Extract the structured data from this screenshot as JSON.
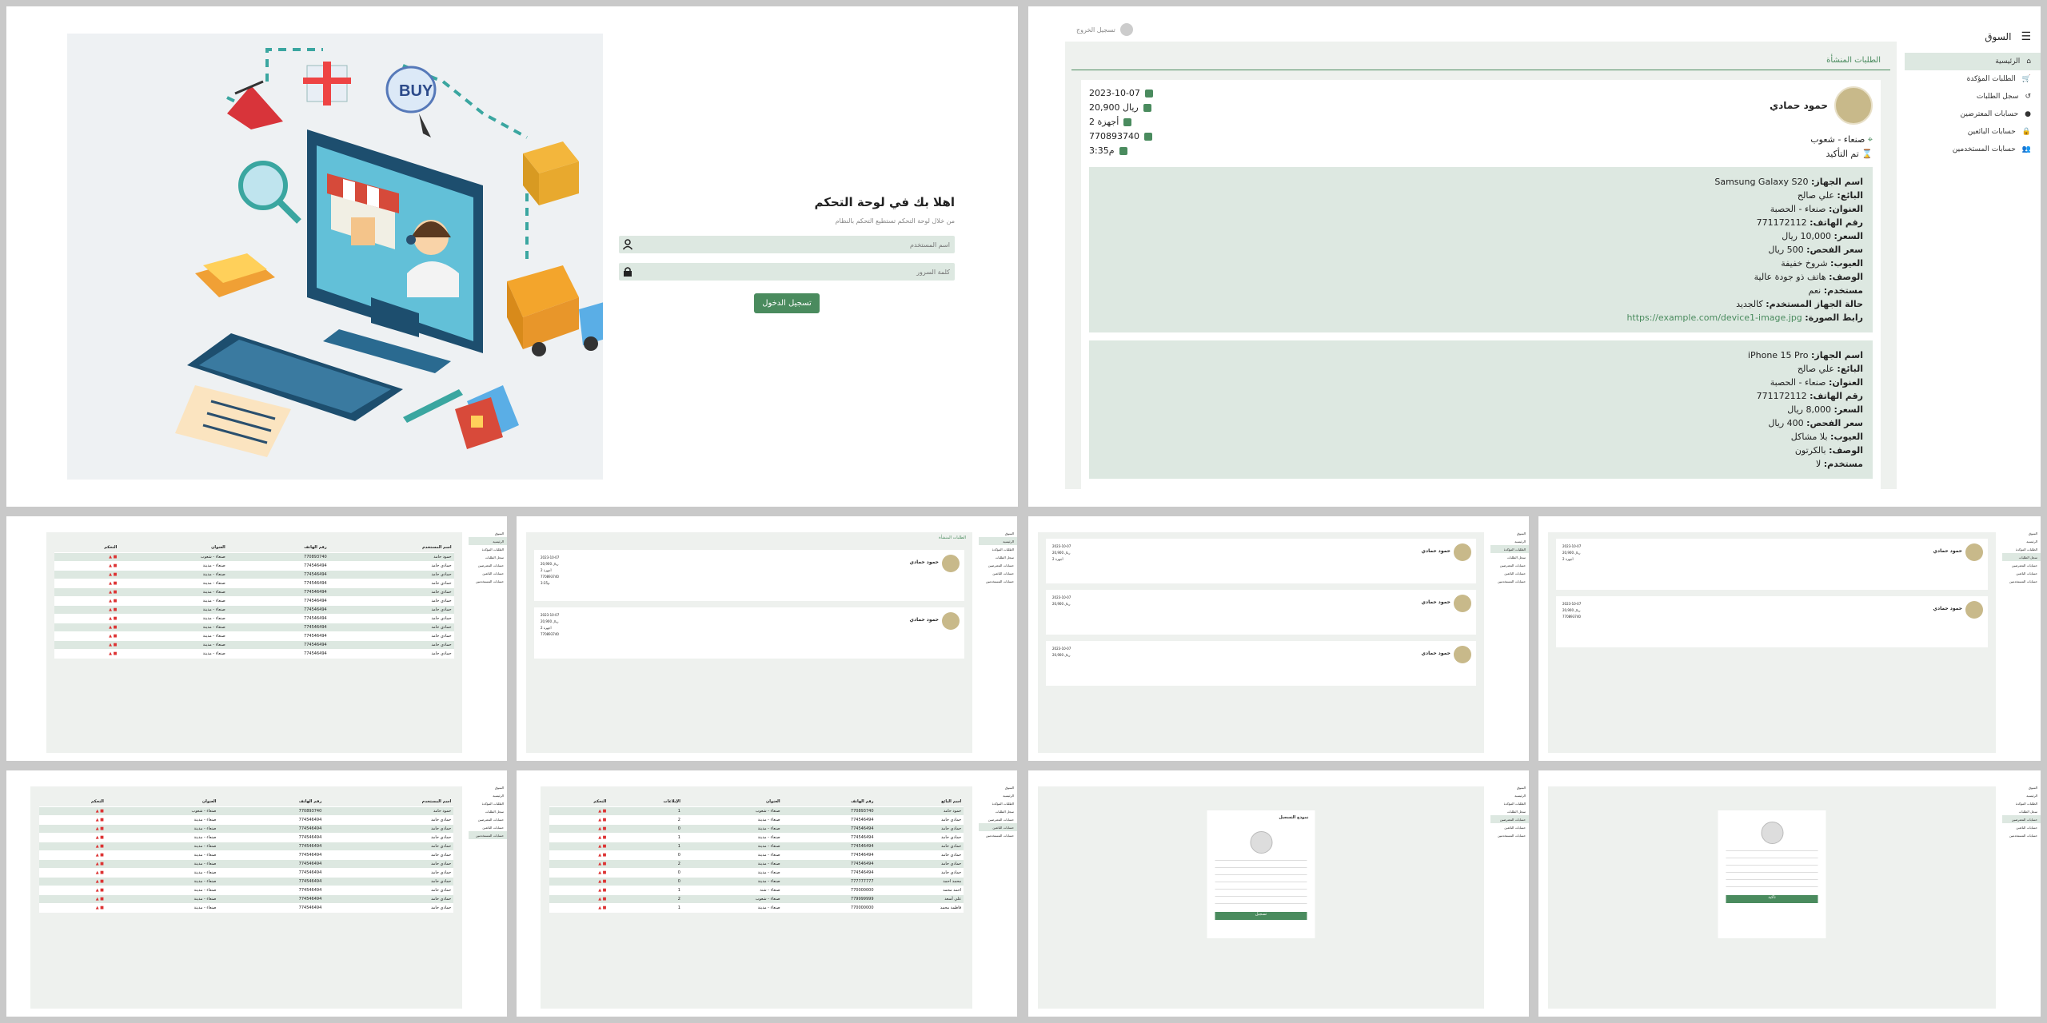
{
  "login": {
    "title": "اهلا بك في لوحة التحكم",
    "subtitle": "من خلال لوحة التحكم تستطيع التحكم بالنظام",
    "username_placeholder": "اسم المستخدم",
    "password_placeholder": "كلمة السرور",
    "submit_label": "تسجيل الدخول",
    "illustration_labels": {
      "buy": "BUY"
    }
  },
  "app": {
    "brand": "السوق",
    "user_label": "تسجيل الخروج"
  },
  "sidebar": {
    "items": [
      {
        "label": "الرئيسية",
        "icon": "home-icon",
        "active": true
      },
      {
        "label": "الطلبات المؤكدة",
        "icon": "cart-icon"
      },
      {
        "label": "سجل الطلبات",
        "icon": "history-icon"
      },
      {
        "label": "حسابات المعترضين",
        "icon": "user-icon"
      },
      {
        "label": "حسابات البائعين",
        "icon": "lock-icon"
      },
      {
        "label": "حسابات المستخدمين",
        "icon": "users-icon"
      }
    ]
  },
  "orders_page": {
    "section_title": "الطلبات المنشأة",
    "order": {
      "seller_name": "حمود حمادي",
      "location": "صنعاء - شعوب",
      "status": "تم التأكيد",
      "date": "2023-10-07",
      "amount": "20,900 ريال",
      "devices_count": "2 أجهزة",
      "phone": "770893740",
      "time": "3:35م"
    },
    "devices": [
      {
        "fields": [
          {
            "label": "اسم الجهاز:",
            "value": "Samsung Galaxy S20"
          },
          {
            "label": "البائع:",
            "value": "علي صالح"
          },
          {
            "label": "العنوان:",
            "value": "صنعاء - الحصبة"
          },
          {
            "label": "رقم الهاتف:",
            "value": "771172112"
          },
          {
            "label": "السعر:",
            "value": "10,000 ريال"
          },
          {
            "label": "سعر الفحص:",
            "value": "500 ريال"
          },
          {
            "label": "العيوب:",
            "value": "شروخ خفيفة"
          },
          {
            "label": "الوصف:",
            "value": "هاتف ذو جودة عالية"
          },
          {
            "label": "مستخدم:",
            "value": "نعم"
          },
          {
            "label": "حالة الجهاز المستخدم:",
            "value": "كالجديد"
          },
          {
            "label": "رابط الصورة:",
            "value": "https://example.com/device1-image.jpg"
          }
        ]
      },
      {
        "fields": [
          {
            "label": "اسم الجهاز:",
            "value": "iPhone 15 Pro"
          },
          {
            "label": "البائع:",
            "value": "علي صالح"
          },
          {
            "label": "العنوان:",
            "value": "صنعاء - الحصبة"
          },
          {
            "label": "رقم الهاتف:",
            "value": "771172112"
          },
          {
            "label": "السعر:",
            "value": "8,000 ريال"
          },
          {
            "label": "سعر الفحص:",
            "value": "400 ريال"
          },
          {
            "label": "العيوب:",
            "value": "بلا مشاكل"
          },
          {
            "label": "الوصف:",
            "value": "بالكرتون"
          },
          {
            "label": "مستخدم:",
            "value": "لا"
          }
        ]
      }
    ]
  },
  "mini": {
    "users_table": {
      "headers": [
        "اسم المستخدم",
        "رقم الهاتف",
        "العنوان",
        "التحكم"
      ],
      "rows": [
        [
          "حمود حامد",
          "770893740",
          "صنعاء - شعوب"
        ],
        [
          "حمادي حامد",
          "774546494",
          "صنعاء - مدينة"
        ],
        [
          "حمادي حامد",
          "774546494",
          "صنعاء - مدينة"
        ],
        [
          "حمادي حامد",
          "774546494",
          "صنعاء - مدينة"
        ],
        [
          "حمادي حامد",
          "774546494",
          "صنعاء - مدينة"
        ],
        [
          "حمادي حامد",
          "774546494",
          "صنعاء - مدينة"
        ],
        [
          "حمادي حامد",
          "774546494",
          "صنعاء - مدينة"
        ],
        [
          "حمادي حامد",
          "774546494",
          "صنعاء - مدينة"
        ],
        [
          "حمادي حامد",
          "774546494",
          "صنعاء - مدينة"
        ],
        [
          "حمادي حامد",
          "774546494",
          "صنعاء - مدينة"
        ],
        [
          "حمادي حامد",
          "774546494",
          "صنعاء - مدينة"
        ],
        [
          "حمادي حامد",
          "774546494",
          "صنعاء - مدينة"
        ]
      ]
    },
    "sellers_table": {
      "headers": [
        "اسم البائع",
        "رقم الهاتف",
        "العنوان",
        "الإبلاغات",
        "التحكم"
      ],
      "rows": [
        [
          "حمود حامد",
          "770893740",
          "صنعاء - شعوب",
          "1"
        ],
        [
          "حمادي حامد",
          "774546494",
          "صنعاء - مدينة",
          "2"
        ],
        [
          "حمادي حامد",
          "774546494",
          "صنعاء - مدينة",
          "0"
        ],
        [
          "حمادي حامد",
          "774546494",
          "صنعاء - مدينة",
          "1"
        ],
        [
          "حمادي حامد",
          "774546494",
          "صنعاء - مدينة",
          "1"
        ],
        [
          "حمادي حامد",
          "774546494",
          "صنعاء - مدينة",
          "0"
        ],
        [
          "حمادي حامد",
          "774546494",
          "صنعاء - مدينة",
          "2"
        ],
        [
          "حمادي حامد",
          "774546494",
          "صنعاء - مدينة",
          "0"
        ],
        [
          "محمد احمد",
          "777777777",
          "صنعاء - مدينة",
          "0"
        ],
        [
          "احمد محمد",
          "770000000",
          "صنعاء - شنة",
          "1"
        ],
        [
          "علي أسعد",
          "779999999",
          "صنعاء - شعوب",
          "2"
        ],
        [
          "فاطمة محمد",
          "770000000",
          "صنعاء - مدينة",
          "1"
        ]
      ]
    },
    "form_title": "نموذج التسجيل",
    "form_button": "تسجيل",
    "profile_button": "تأكيد"
  }
}
